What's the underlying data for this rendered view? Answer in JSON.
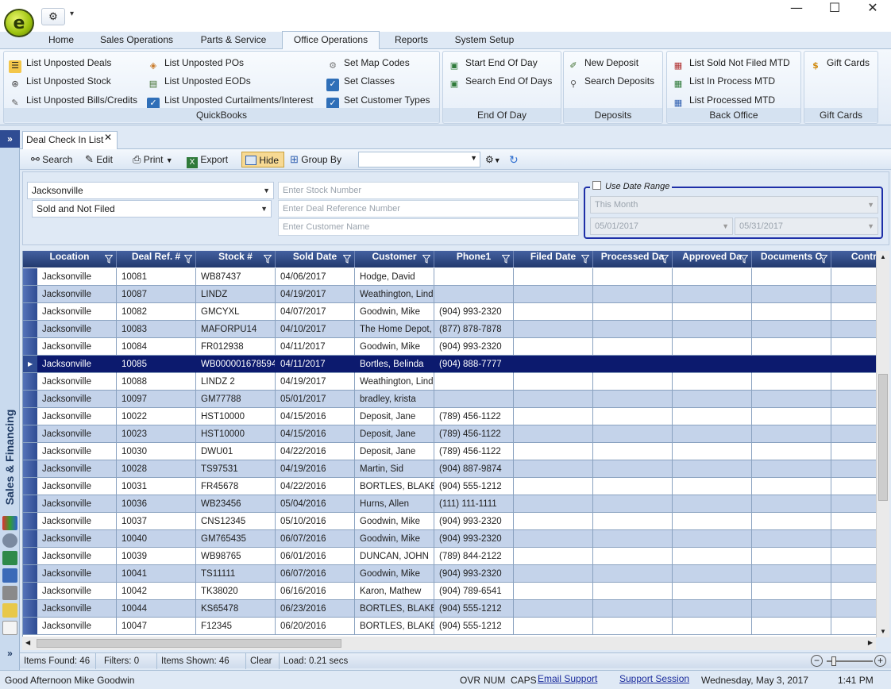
{
  "quick_access": {
    "dropdown_glyph": "▾"
  },
  "window_controls": {
    "minimize": "—",
    "maximize": "☐",
    "close": "✕"
  },
  "menu_tabs": [
    "Home",
    "Sales Operations",
    "Parts & Service",
    "Office Operations",
    "Reports",
    "System Setup"
  ],
  "ribbon": {
    "quickbooks": {
      "label": "QuickBooks",
      "items": [
        "List Unposted Deals",
        "List Unposted Stock",
        "List Unposted Bills/Credits",
        "List Unposted POs",
        "List Unposted EODs",
        "List Unposted Curtailments/Interest",
        "Set Map Codes",
        "Set Classes",
        "Set Customer Types"
      ]
    },
    "end_of_day": {
      "label": "End Of Day",
      "items": [
        "Start End Of Day",
        "Search End Of Days"
      ]
    },
    "deposits": {
      "label": "Deposits",
      "items": [
        "New Deposit",
        "Search Deposits"
      ]
    },
    "back_office": {
      "label": "Back Office",
      "items": [
        "List Sold Not Filed MTD",
        "List In Process MTD",
        "List Processed MTD"
      ]
    },
    "gift_cards": {
      "label": "Gift Cards",
      "items": [
        "Gift Cards"
      ]
    }
  },
  "side_title": "Sales & Financing",
  "side_toggle": "»",
  "document_tab": {
    "label": "Deal Check In List",
    "close": "✕"
  },
  "toolbar": {
    "search": "Search",
    "edit": "Edit",
    "print": "Print",
    "export": "Export",
    "hide": "Hide",
    "group_by": "Group By",
    "group_by_value": ""
  },
  "filters": {
    "location": "Jacksonville",
    "status": "Sold and Not Filed",
    "stock_placeholder": "Enter Stock Number",
    "deal_ref_placeholder": "Enter Deal Reference Number",
    "customer_placeholder": "Enter Customer Name",
    "date_range_label": "Use Date Range",
    "date_range_checked": false,
    "period": "This Month",
    "date_from": "05/01/2017",
    "date_to": "05/31/2017"
  },
  "grid": {
    "columns": [
      "Location",
      "Deal Ref. #",
      "Stock #",
      "Sold Date",
      "Customer",
      "Phone1",
      "Filed Date",
      "Processed Da",
      "Approved Da",
      "Documents C",
      "Contract"
    ],
    "selected_row": 5,
    "rows": [
      [
        "Jacksonville",
        "10081",
        "WB87437",
        "04/06/2017",
        "Hodge, David",
        ""
      ],
      [
        "Jacksonville",
        "10087",
        "LINDZ",
        "04/19/2017",
        "Weathington, Lind",
        ""
      ],
      [
        "Jacksonville",
        "10082",
        "GMCYXL",
        "04/07/2017",
        "Goodwin, Mike",
        "(904) 993-2320"
      ],
      [
        "Jacksonville",
        "10083",
        "MAFORPU14",
        "04/10/2017",
        "The Home Depot,",
        "(877) 878-7878"
      ],
      [
        "Jacksonville",
        "10084",
        "FR012938",
        "04/11/2017",
        "Goodwin, Mike",
        "(904) 993-2320"
      ],
      [
        "Jacksonville",
        "10085",
        "WB000001678594",
        "04/11/2017",
        "Bortles, Belinda",
        "(904) 888-7777"
      ],
      [
        "Jacksonville",
        "10088",
        "LINDZ 2",
        "04/19/2017",
        "Weathington, Lind",
        ""
      ],
      [
        "Jacksonville",
        "10097",
        "GM77788",
        "05/01/2017",
        "bradley, krista",
        ""
      ],
      [
        "Jacksonville",
        "10022",
        "HST10000",
        "04/15/2016",
        "Deposit, Jane",
        "(789) 456-1122"
      ],
      [
        "Jacksonville",
        "10023",
        "HST10000",
        "04/15/2016",
        "Deposit, Jane",
        "(789) 456-1122"
      ],
      [
        "Jacksonville",
        "10030",
        "DWU01",
        "04/22/2016",
        "Deposit, Jane",
        "(789) 456-1122"
      ],
      [
        "Jacksonville",
        "10028",
        "TS97531",
        "04/19/2016",
        "Martin, Sid",
        "(904) 887-9874"
      ],
      [
        "Jacksonville",
        "10031",
        "FR45678",
        "04/22/2016",
        "BORTLES, BLAKE",
        "(904) 555-1212"
      ],
      [
        "Jacksonville",
        "10036",
        "WB23456",
        "05/04/2016",
        "Hurns, Allen",
        "(111) 111-1111"
      ],
      [
        "Jacksonville",
        "10037",
        "CNS12345",
        "05/10/2016",
        "Goodwin, Mike",
        "(904) 993-2320"
      ],
      [
        "Jacksonville",
        "10040",
        "GM765435",
        "06/07/2016",
        "Goodwin, Mike",
        "(904) 993-2320"
      ],
      [
        "Jacksonville",
        "10039",
        "WB98765",
        "06/01/2016",
        "DUNCAN, JOHN",
        "(789) 844-2122"
      ],
      [
        "Jacksonville",
        "10041",
        "TS11111",
        "06/07/2016",
        "Goodwin, Mike",
        "(904) 993-2320"
      ],
      [
        "Jacksonville",
        "10042",
        "TK38020",
        "06/16/2016",
        "Karon, Mathew",
        "(904) 789-6541"
      ],
      [
        "Jacksonville",
        "10044",
        "KS65478",
        "06/23/2016",
        "BORTLES, BLAKE",
        "(904) 555-1212"
      ],
      [
        "Jacksonville",
        "10047",
        "F12345",
        "06/20/2016",
        "BORTLES, BLAKE",
        "(904) 555-1212"
      ]
    ]
  },
  "status": {
    "items_found": "Items Found: 46",
    "filters": "Filters: 0",
    "items_shown": "Items Shown: 46",
    "clear": "Clear",
    "load": "Load: 0.21 secs"
  },
  "bottom_bar": {
    "greeting": "Good Afternoon Mike Goodwin",
    "ovr": "OVR",
    "num": "NUM",
    "caps": "CAPS",
    "email_support": "Email Support",
    "support_session": "Support Session",
    "date": "Wednesday, May 3, 2017",
    "time": "1:41 PM"
  },
  "colors": {
    "header_bg": "#22396e",
    "selected_row": "#0c1a6e",
    "alt_row": "#c4d3ea",
    "hide_button": "#f7d993"
  }
}
